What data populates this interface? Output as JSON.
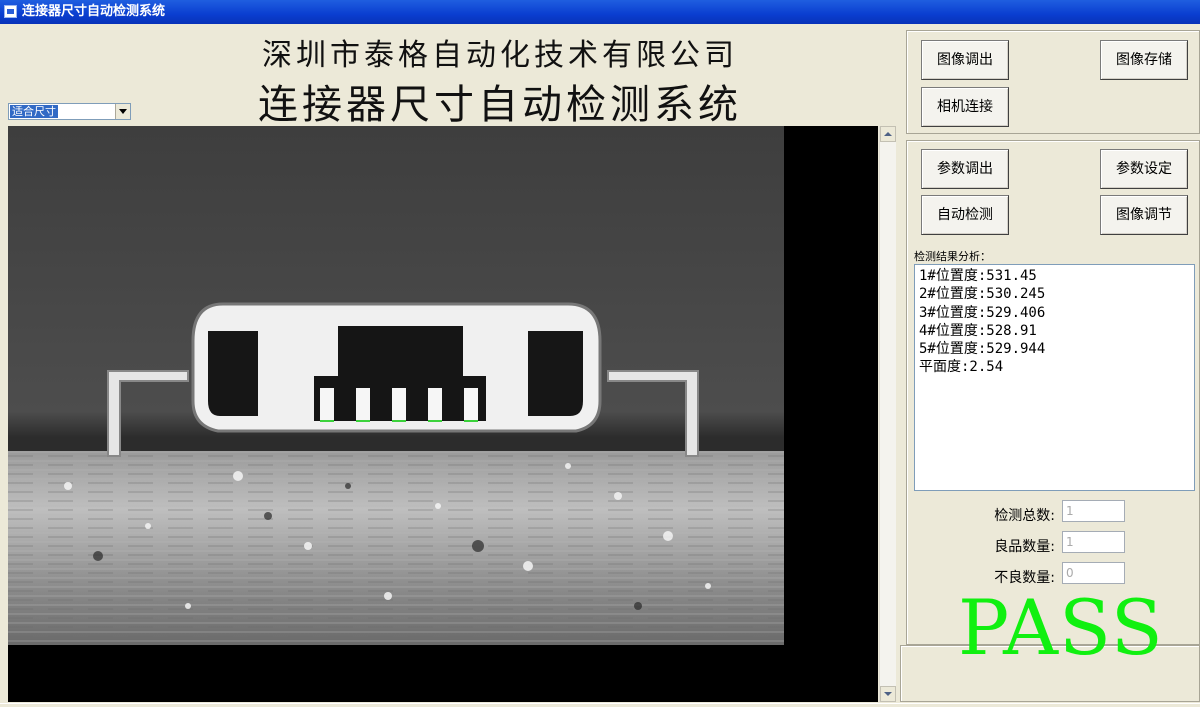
{
  "window": {
    "title": "连接器尺寸自动检测系统"
  },
  "header": {
    "company": "深圳市泰格自动化技术有限公司",
    "system": "连接器尺寸自动检测系统"
  },
  "view": {
    "size_mode": "适合尺寸"
  },
  "buttons": {
    "image_load": "图像调出",
    "image_save": "图像存储",
    "camera_connect": "相机连接",
    "param_load": "参数调出",
    "param_set": "参数设定",
    "auto_detect": "自动检测",
    "image_adjust": "图像调节"
  },
  "results": {
    "label": "检测结果分析：",
    "lines": [
      "1#位置度:531.45",
      "2#位置度:530.245",
      "3#位置度:529.406",
      "4#位置度:528.91",
      "5#位置度:529.944",
      "平面度:2.54"
    ]
  },
  "stats": {
    "total_label": "检测总数:",
    "total_value": "1",
    "good_label": "良品数量:",
    "good_value": "1",
    "bad_label": "不良数量:",
    "bad_value": "0"
  },
  "verdict": {
    "text": "PASS",
    "color": "#10f010"
  }
}
